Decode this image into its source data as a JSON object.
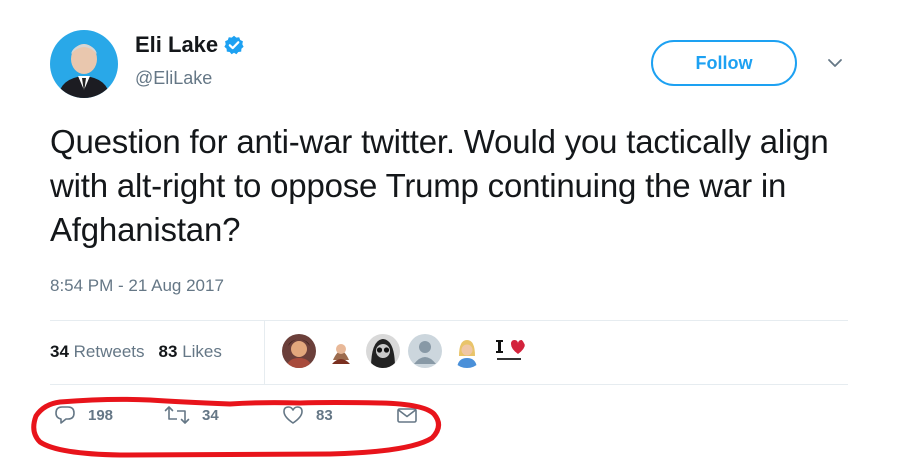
{
  "user": {
    "display_name": "Eli Lake",
    "handle": "@EliLake",
    "verified_icon": "verified-badge-icon",
    "avatar_icon": "profile-avatar"
  },
  "header": {
    "follow_label": "Follow",
    "more_icon": "chevron-down-icon"
  },
  "tweet": {
    "text": "Question for anti-war twitter. Would you tactically align with alt-right to oppose Trump continuing the war in Afghanistan?",
    "timestamp": "8:54 PM - 21 Aug 2017"
  },
  "stats": {
    "retweets_count": "34",
    "retweets_label": "Retweets",
    "likes_count": "83",
    "likes_label": "Likes"
  },
  "actions": {
    "reply_count": "198",
    "retweet_count": "34",
    "like_count": "83"
  },
  "colors": {
    "accent": "#1da1f2",
    "text": "#14171a",
    "secondary": "#657786",
    "annotation": "#e8141b"
  }
}
